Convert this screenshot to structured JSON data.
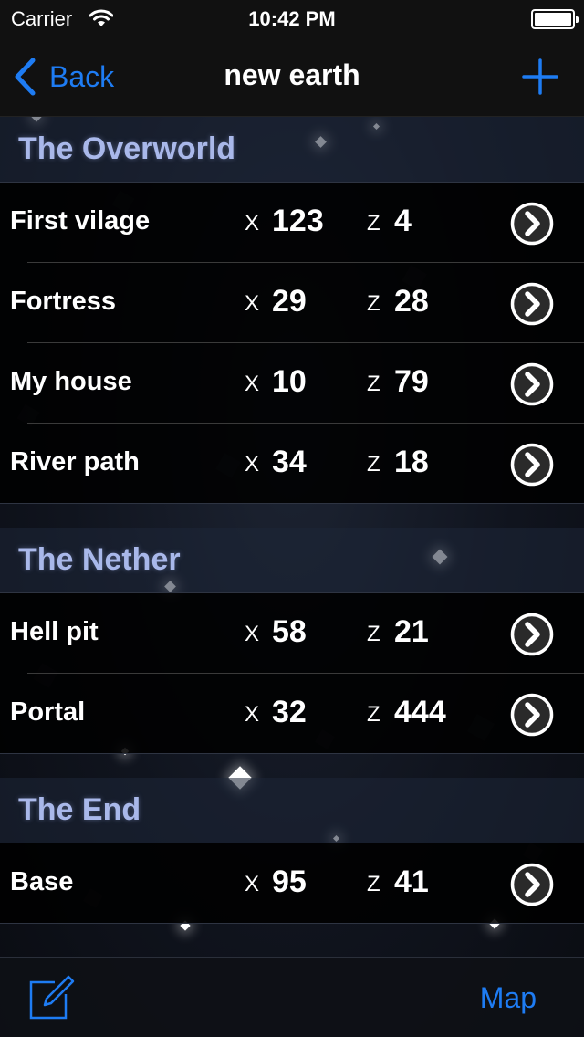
{
  "status_bar": {
    "carrier": "Carrier",
    "time": "10:42 PM"
  },
  "nav": {
    "back_label": "Back",
    "title": "new earth",
    "add_icon": "plus-icon"
  },
  "sections": [
    {
      "title": "The Overworld",
      "rows": [
        {
          "name": "First vilage",
          "x_label": "X",
          "x": "123",
          "z_label": "Z",
          "z": "4"
        },
        {
          "name": "Fortress",
          "x_label": "X",
          "x": "29",
          "z_label": "Z",
          "z": "28"
        },
        {
          "name": "My house",
          "x_label": "X",
          "x": "10",
          "z_label": "Z",
          "z": "79"
        },
        {
          "name": "River path",
          "x_label": "X",
          "x": "34",
          "z_label": "Z",
          "z": "18"
        }
      ]
    },
    {
      "title": "The Nether",
      "rows": [
        {
          "name": "Hell pit",
          "x_label": "X",
          "x": "58",
          "z_label": "Z",
          "z": "21"
        },
        {
          "name": "Portal",
          "x_label": "X",
          "x": "32",
          "z_label": "Z",
          "z": "444"
        }
      ]
    },
    {
      "title": "The End",
      "rows": [
        {
          "name": "Base",
          "x_label": "X",
          "x": "95",
          "z_label": "Z",
          "z": "41"
        }
      ]
    }
  ],
  "toolbar": {
    "compose_icon": "compose-icon",
    "map_label": "Map"
  },
  "colors": {
    "accent": "#1e7cf3",
    "section_title": "#a9b8ea",
    "row_background": "#000000"
  }
}
